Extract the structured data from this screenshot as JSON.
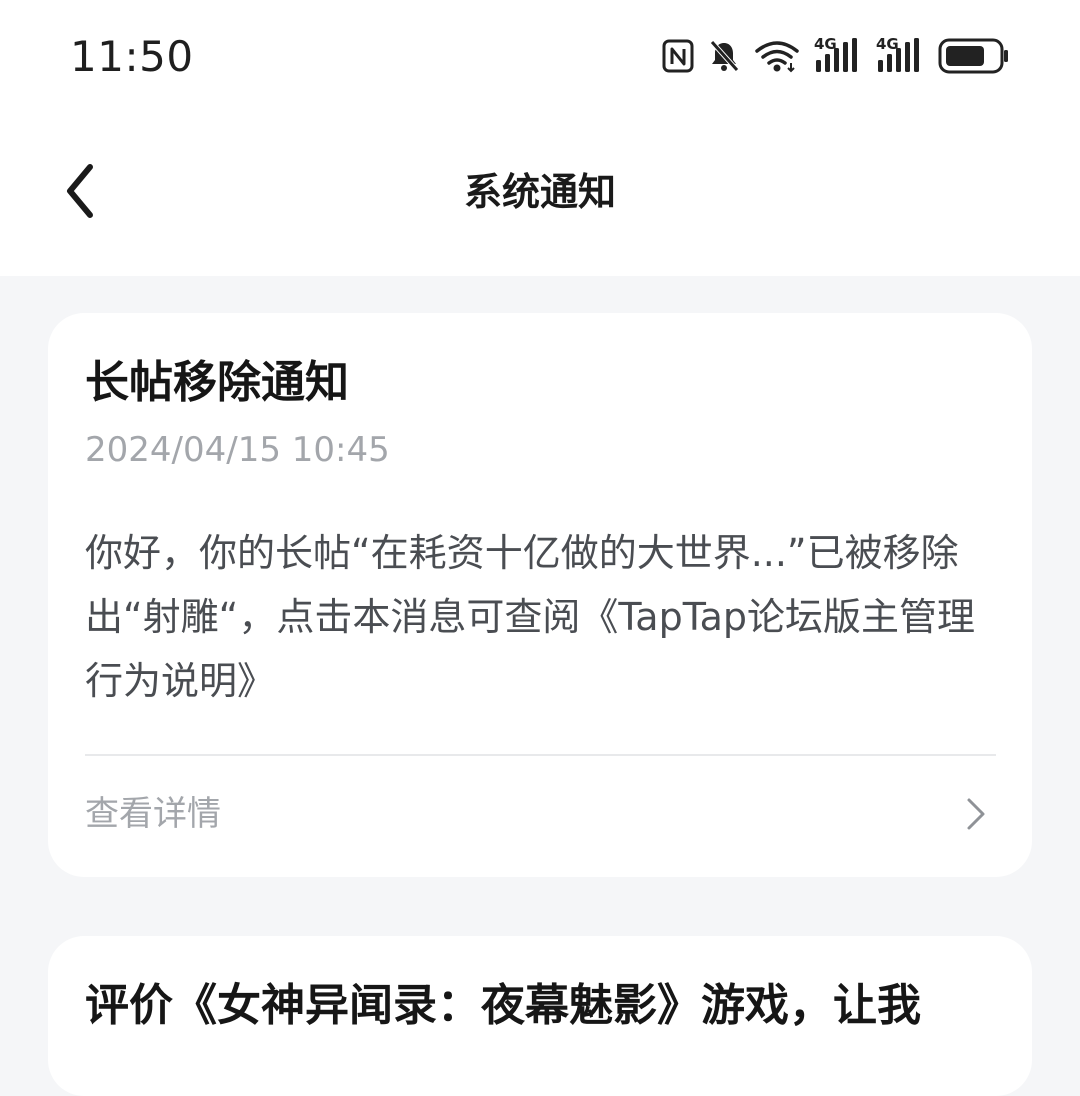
{
  "status_bar": {
    "time": "11:50",
    "icons": [
      "nfc-icon",
      "bell-muted-icon",
      "wifi-icon",
      "signal-4g-icon",
      "signal-4g-icon",
      "battery-icon"
    ],
    "network_label_1": "4G",
    "network_label_2": "4G"
  },
  "header": {
    "title": "系统通知"
  },
  "notifications": [
    {
      "title": "长帖移除通知",
      "time": "2024/04/15 10:45",
      "body": "你好，你的长帖“在耗资十亿做的大世界...”已被移除出“射雕“，点击本消息可查阅《TapTap论坛版主管理行为说明》",
      "detail_label": "查看详情"
    },
    {
      "title": "评价《女神异闻录：夜幕魅影》游戏，让我"
    }
  ],
  "colors": {
    "background": "#f5f6f8",
    "card": "#ffffff",
    "title_text": "#161616",
    "secondary_text": "#a3a6ab",
    "body_text": "#4a4d52"
  }
}
